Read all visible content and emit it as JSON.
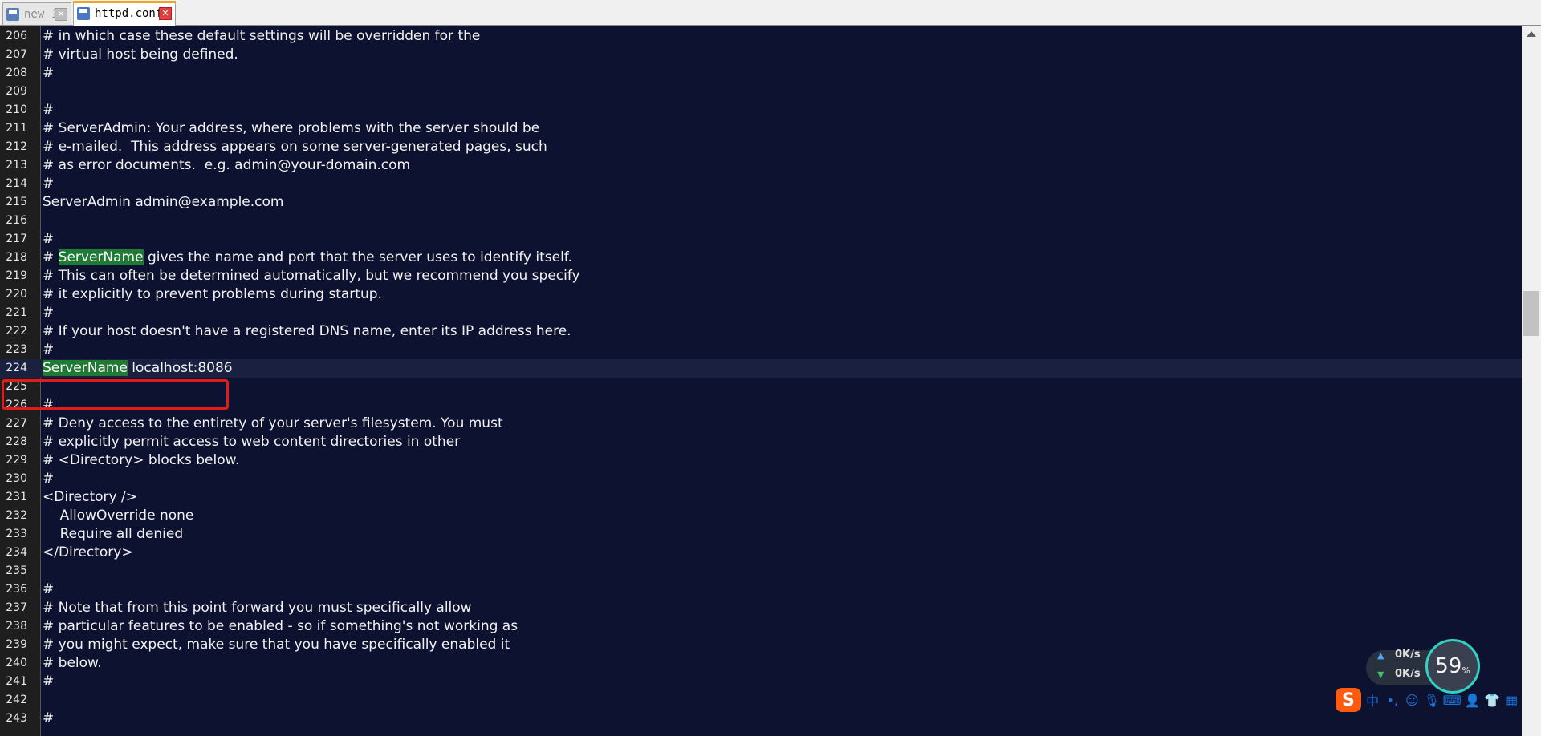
{
  "tabs": [
    {
      "label": "new 1",
      "active": false
    },
    {
      "label": "httpd.conf",
      "active": true
    }
  ],
  "editor": {
    "current_line": "224",
    "lines": [
      {
        "n": "206",
        "parts": [
          {
            "t": "# in which case these default settings will be overridden for the"
          }
        ]
      },
      {
        "n": "207",
        "parts": [
          {
            "t": "# virtual host being defined."
          }
        ]
      },
      {
        "n": "208",
        "parts": [
          {
            "t": "#"
          }
        ]
      },
      {
        "n": "209",
        "parts": [
          {
            "t": ""
          }
        ]
      },
      {
        "n": "210",
        "parts": [
          {
            "t": "#"
          }
        ]
      },
      {
        "n": "211",
        "parts": [
          {
            "t": "# ServerAdmin: Your address, where problems with the server should be"
          }
        ]
      },
      {
        "n": "212",
        "parts": [
          {
            "t": "# e-mailed.  This address appears on some server-generated pages, such"
          }
        ]
      },
      {
        "n": "213",
        "parts": [
          {
            "t": "# as error documents.  e.g. admin@your-domain.com"
          }
        ]
      },
      {
        "n": "214",
        "parts": [
          {
            "t": "#"
          }
        ]
      },
      {
        "n": "215",
        "parts": [
          {
            "t": "ServerAdmin admin@example.com"
          }
        ]
      },
      {
        "n": "216",
        "parts": [
          {
            "t": ""
          }
        ]
      },
      {
        "n": "217",
        "parts": [
          {
            "t": "#"
          }
        ]
      },
      {
        "n": "218",
        "parts": [
          {
            "t": "# "
          },
          {
            "t": "ServerName",
            "hl": true
          },
          {
            "t": " gives the name and port that the server uses to identify itself."
          }
        ]
      },
      {
        "n": "219",
        "parts": [
          {
            "t": "# This can often be determined automatically, but we recommend you specify"
          }
        ]
      },
      {
        "n": "220",
        "parts": [
          {
            "t": "# it explicitly to prevent problems during startup."
          }
        ]
      },
      {
        "n": "221",
        "parts": [
          {
            "t": "#"
          }
        ]
      },
      {
        "n": "222",
        "parts": [
          {
            "t": "# If your host doesn't have a registered DNS name, enter its IP address here."
          }
        ]
      },
      {
        "n": "223",
        "parts": [
          {
            "t": "#"
          }
        ]
      },
      {
        "n": "224",
        "parts": [
          {
            "t": "ServerName",
            "hl": true
          },
          {
            "t": " localhost:8086"
          }
        ]
      },
      {
        "n": "225",
        "parts": [
          {
            "t": ""
          }
        ]
      },
      {
        "n": "226",
        "parts": [
          {
            "t": "#"
          }
        ]
      },
      {
        "n": "227",
        "parts": [
          {
            "t": "# Deny access to the entirety of your server's filesystem. You must"
          }
        ]
      },
      {
        "n": "228",
        "parts": [
          {
            "t": "# explicitly permit access to web content directories in other"
          }
        ]
      },
      {
        "n": "229",
        "parts": [
          {
            "t": "# <Directory> blocks below."
          }
        ]
      },
      {
        "n": "230",
        "parts": [
          {
            "t": "#"
          }
        ]
      },
      {
        "n": "231",
        "parts": [
          {
            "t": "<Directory />"
          }
        ]
      },
      {
        "n": "232",
        "parts": [
          {
            "t": "    AllowOverride none"
          }
        ]
      },
      {
        "n": "233",
        "parts": [
          {
            "t": "    Require all denied"
          }
        ]
      },
      {
        "n": "234",
        "parts": [
          {
            "t": "</Directory>"
          }
        ]
      },
      {
        "n": "235",
        "parts": [
          {
            "t": ""
          }
        ]
      },
      {
        "n": "236",
        "parts": [
          {
            "t": "#"
          }
        ]
      },
      {
        "n": "237",
        "parts": [
          {
            "t": "# Note that from this point forward you must specifically allow"
          }
        ]
      },
      {
        "n": "238",
        "parts": [
          {
            "t": "# particular features to be enabled - so if something's not working as"
          }
        ]
      },
      {
        "n": "239",
        "parts": [
          {
            "t": "# you might expect, make sure that you have specifically enabled it"
          }
        ]
      },
      {
        "n": "240",
        "parts": [
          {
            "t": "# below."
          }
        ]
      },
      {
        "n": "241",
        "parts": [
          {
            "t": "#"
          }
        ]
      },
      {
        "n": "242",
        "parts": [
          {
            "t": ""
          }
        ]
      },
      {
        "n": "243",
        "parts": [
          {
            "t": "#"
          }
        ]
      }
    ]
  },
  "net_widget": {
    "upload_speed": "0K/s",
    "download_speed": "0K/s",
    "cpu_percent": "59",
    "percent_sign": "%"
  },
  "ime_toolbar": {
    "logo": "S",
    "mode": "中",
    "punct": "•,",
    "icons": [
      "smiley-icon",
      "microphone-icon",
      "keyboard-icon",
      "user-icon",
      "shirt-icon",
      "grid-icon"
    ]
  },
  "colors": {
    "editor_bg": "#0d1230",
    "highlight": "#1f7a34",
    "annotation_box": "#e41b1b",
    "active_tab_accent": "#f5a623"
  }
}
